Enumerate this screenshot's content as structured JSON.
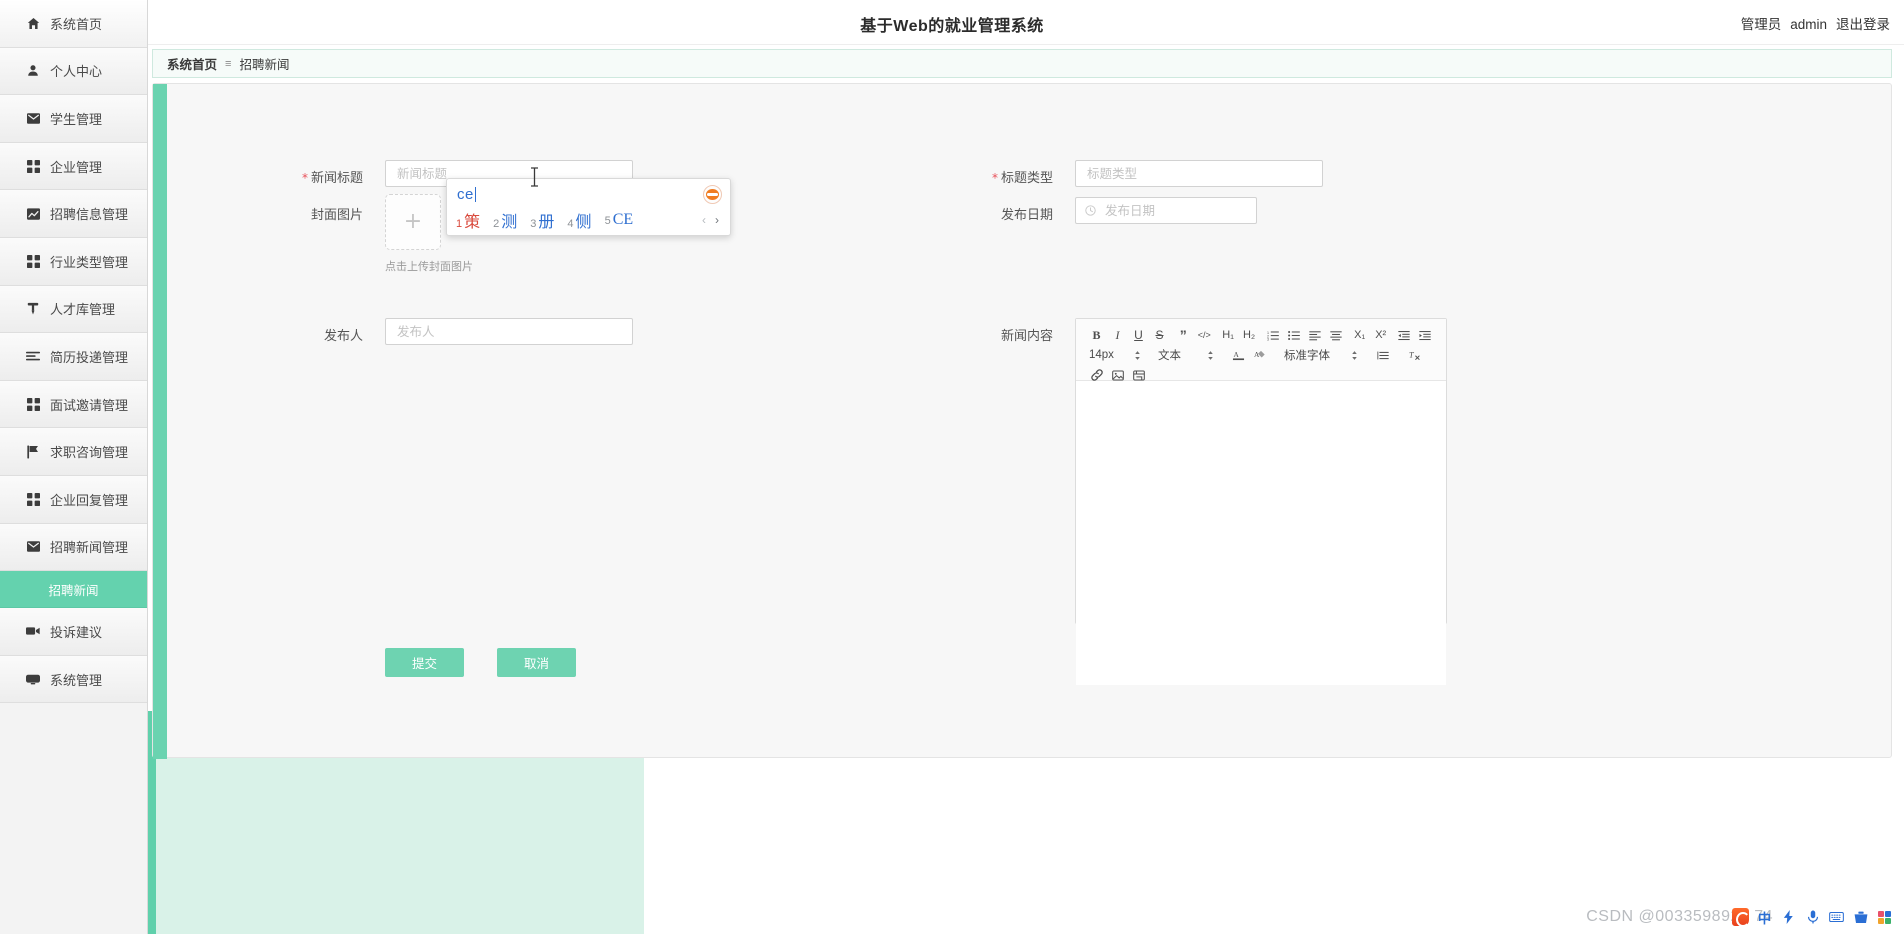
{
  "header": {
    "title": "基于Web的就业管理系统",
    "role": "管理员",
    "username": "admin",
    "logout": "退出登录"
  },
  "sidebar": {
    "items": [
      {
        "label": "系统首页",
        "icon": "home-icon"
      },
      {
        "label": "个人中心",
        "icon": "user-icon"
      },
      {
        "label": "学生管理",
        "icon": "envelope-icon"
      },
      {
        "label": "企业管理",
        "icon": "grid-icon"
      },
      {
        "label": "招聘信息管理",
        "icon": "chart-icon"
      },
      {
        "label": "行业类型管理",
        "icon": "grid-icon"
      },
      {
        "label": "人才库管理",
        "icon": "pin-icon"
      },
      {
        "label": "简历投递管理",
        "icon": "lines-icon"
      },
      {
        "label": "面试邀请管理",
        "icon": "grid-icon"
      },
      {
        "label": "求职咨询管理",
        "icon": "flag-icon"
      },
      {
        "label": "企业回复管理",
        "icon": "grid-icon"
      },
      {
        "label": "招聘新闻管理",
        "icon": "envelope-icon"
      }
    ],
    "active_sub": "招聘新闻",
    "trailing": [
      {
        "label": "投诉建议",
        "icon": "video-icon"
      },
      {
        "label": "系统管理",
        "icon": "monitor-icon"
      }
    ]
  },
  "breadcrumb": {
    "home": "系统首页",
    "separator": "≡",
    "current": "招聘新闻"
  },
  "form": {
    "news_title": {
      "label": "新闻标题",
      "required": true,
      "value": "",
      "placeholder": "新闻标题"
    },
    "title_type": {
      "label": "标题类型",
      "required": true,
      "value": "",
      "placeholder": "标题类型"
    },
    "cover_image": {
      "label": "封面图片",
      "required": false,
      "upload_plus": "+",
      "hint": "点击上传封面图片"
    },
    "publish_date": {
      "label": "发布日期",
      "required": false,
      "value": "",
      "placeholder": "发布日期",
      "icon": "clock-icon"
    },
    "publisher": {
      "label": "发布人",
      "required": false,
      "value": "",
      "placeholder": "发布人"
    },
    "news_content": {
      "label": "新闻内容",
      "required": false,
      "value": ""
    }
  },
  "editor": {
    "row1": [
      {
        "name": "bold-icon",
        "glyph": "B"
      },
      {
        "name": "italic-icon",
        "glyph": "I"
      },
      {
        "name": "underline-icon",
        "glyph": "U"
      },
      {
        "name": "strikethrough-icon",
        "glyph": "S"
      },
      {
        "name": "blockquote-icon",
        "glyph": "”"
      },
      {
        "name": "code-icon",
        "glyph": "</>"
      },
      {
        "name": "heading-1-icon",
        "glyph": "H₁"
      },
      {
        "name": "heading-2-icon",
        "glyph": "H₂"
      },
      {
        "name": "ordered-list-icon",
        "glyph": "list"
      },
      {
        "name": "unordered-list-icon",
        "glyph": "list"
      },
      {
        "name": "align-left-icon",
        "glyph": "align"
      },
      {
        "name": "align-center-icon",
        "glyph": "align"
      },
      {
        "name": "subscript-icon",
        "glyph": "X₁"
      },
      {
        "name": "superscript-icon",
        "glyph": "X²"
      },
      {
        "name": "outdent-icon",
        "glyph": "indent"
      },
      {
        "name": "indent-icon",
        "glyph": "indent"
      }
    ],
    "font_size": "14px",
    "text_style": "文本",
    "font_family": "标准字体",
    "font_color_icon": "font-color-icon",
    "highlight_icon": "highlight-icon",
    "line_height_icon": "line-height-icon",
    "clear-format_icon": "clear-format-icon",
    "row3": [
      {
        "name": "link-icon"
      },
      {
        "name": "image-icon"
      },
      {
        "name": "video-icon"
      }
    ]
  },
  "actions": {
    "submit": "提交",
    "cancel": "取消"
  },
  "ime": {
    "typed": "ce",
    "logo": "sogou-logo-icon",
    "candidates": [
      {
        "num": "1",
        "word": "策",
        "active": true
      },
      {
        "num": "2",
        "word": "测",
        "active": false
      },
      {
        "num": "3",
        "word": "册",
        "active": false
      },
      {
        "num": "4",
        "word": "侧",
        "active": false
      },
      {
        "num": "5",
        "word": "CE",
        "active": false
      }
    ],
    "prev": "‹",
    "next": "›"
  },
  "watermark": {
    "text": "CSDN @0033598921 74"
  },
  "ime_taskbar": {
    "items": [
      {
        "name": "sogou-logo-icon"
      },
      {
        "name": "chinese-mode-icon",
        "glyph": "中"
      },
      {
        "name": "quick-input-icon"
      },
      {
        "name": "voice-input-icon"
      },
      {
        "name": "soft-keyboard-icon"
      },
      {
        "name": "toolbox-icon"
      },
      {
        "name": "apps-grid-icon"
      }
    ]
  },
  "colors": {
    "accent_green": "#6ad3b0",
    "sidebar_bg": "#f3f3f3",
    "card_bg": "#f7f7f7",
    "ime_active": "#d94a3d",
    "ime_blue": "#2f6fd0",
    "required_star": "#e8515a"
  }
}
